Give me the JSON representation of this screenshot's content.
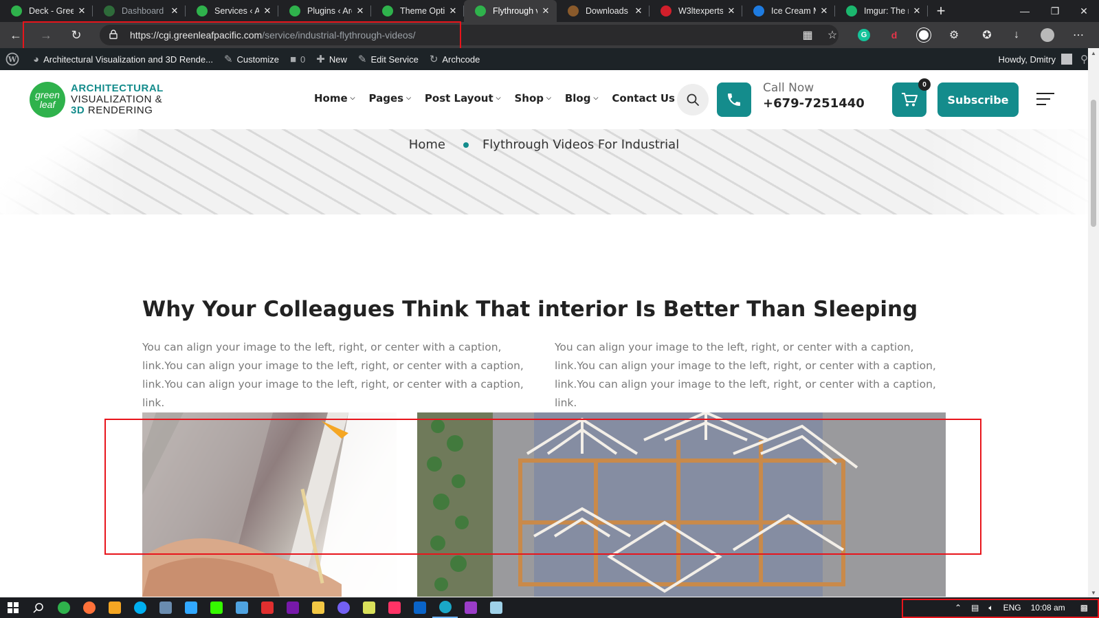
{
  "browser": {
    "tabs": [
      {
        "label": "Deck - Green",
        "favicon_color": "#2fb24c",
        "state": "normal"
      },
      {
        "label": "Dashboard - ",
        "favicon_color": "#2e6b3a",
        "state": "dim"
      },
      {
        "label": "Services ‹ Arc",
        "favicon_color": "#2fb24c",
        "state": "normal"
      },
      {
        "label": "Plugins ‹ Arch",
        "favicon_color": "#2fb24c",
        "state": "normal"
      },
      {
        "label": "Theme Option",
        "favicon_color": "#2fb24c",
        "state": "normal"
      },
      {
        "label": "Flythrough vi",
        "favicon_color": "#2fb24c",
        "state": "active"
      },
      {
        "label": "Downloads | T",
        "favicon_color": "#8a5a2b",
        "state": "normal"
      },
      {
        "label": "W3ltexperts",
        "favicon_color": "#d11f2b",
        "state": "normal"
      },
      {
        "label": "Ice Cream Ma",
        "favicon_color": "#1e7be0",
        "state": "normal"
      },
      {
        "label": "Imgur: The m",
        "favicon_color": "#1bb76e",
        "state": "normal"
      }
    ],
    "url_host": "https://cgi.greenleafpacific.com",
    "url_path": "/service/industrial-flythrough-videos/"
  },
  "adminbar": {
    "site_name": "Architectural Visualization and 3D Rende...",
    "customize": "Customize",
    "comments_count": "0",
    "new": "New",
    "edit": "Edit Service",
    "archcode": "Archcode",
    "howdy": "Howdy, Dmitry"
  },
  "header": {
    "logo_mark": "green leaf",
    "logo_line1": "ARCHITECTURAL",
    "logo_line2": "VISUALIZATION &",
    "logo_line3_accent": "3D",
    "logo_line3_rest": " RENDERING",
    "nav": [
      {
        "label": "Home",
        "has_dropdown": true
      },
      {
        "label": "Pages",
        "has_dropdown": true
      },
      {
        "label": "Post Layout",
        "has_dropdown": true
      },
      {
        "label": "Shop",
        "has_dropdown": true
      },
      {
        "label": "Blog",
        "has_dropdown": true
      },
      {
        "label": "Contact Us",
        "has_dropdown": false
      }
    ],
    "call_label": "Call Now",
    "phone": "+679-7251440",
    "cart_count": "0",
    "subscribe": "Subscribe"
  },
  "breadcrumb": {
    "home": "Home",
    "current": "Flythrough Videos For Industrial"
  },
  "content": {
    "title": "Why Your Colleagues Think That interior Is Better Than Sleeping",
    "para_left": "You can align your image to the left, right, or center with a caption, link.You can align your image to the left, right, or center with a caption, link.You can align your image to the left, right, or center with a caption, link.",
    "para_right": "You can align your image to the left, right, or center with a caption, link.You can align your image to the left, right, or center with a caption, link.You can align your image to the left, right, or center with a caption, link."
  },
  "taskbar": {
    "apps": [
      {
        "name": "windows-start",
        "color": "#ffffff"
      },
      {
        "name": "search",
        "color": "#ffffff"
      },
      {
        "name": "chrome-green",
        "color": "#2fb24c"
      },
      {
        "name": "firefox",
        "color": "#ff7139"
      },
      {
        "name": "search-orange",
        "color": "#f5a623"
      },
      {
        "name": "skype",
        "color": "#00aff0"
      },
      {
        "name": "desktop-app",
        "color": "#6a8caf"
      },
      {
        "name": "photoshop",
        "color": "#31a8ff"
      },
      {
        "name": "dreamweaver",
        "color": "#35fa00"
      },
      {
        "name": "cloud-app",
        "color": "#4fa3e0"
      },
      {
        "name": "acrobat",
        "color": "#e02f2f"
      },
      {
        "name": "onenote",
        "color": "#7719aa"
      },
      {
        "name": "file-explorer",
        "color": "#f2c744"
      },
      {
        "name": "viber",
        "color": "#7360f2"
      },
      {
        "name": "notes",
        "color": "#d9e05a"
      },
      {
        "name": "indesign",
        "color": "#ff3366"
      },
      {
        "name": "outlook",
        "color": "#0a64c8"
      },
      {
        "name": "edge",
        "color": "#1aa7c7"
      },
      {
        "name": "app-g",
        "color": "#9b3dc8"
      },
      {
        "name": "notepad",
        "color": "#9fd1e8"
      }
    ],
    "language": "ENG",
    "time": "10:08 am"
  }
}
